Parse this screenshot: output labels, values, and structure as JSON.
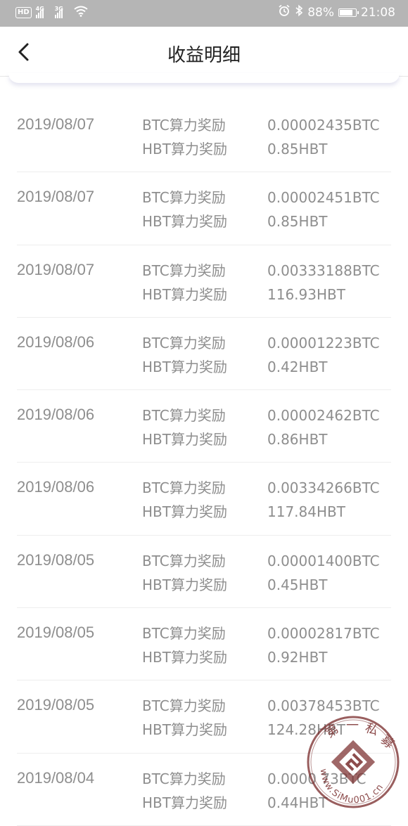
{
  "status_bar": {
    "left_badge": "HD",
    "net1": "4G",
    "net2": "3G",
    "battery_text": "88%",
    "battery_level": 0.88,
    "time": "21:08"
  },
  "header": {
    "title": "收益明细"
  },
  "records": [
    {
      "date": "2019/08/07",
      "btc_label": "BTC算力奖励",
      "hbt_label": "HBT算力奖励",
      "btc_value": "0.00002435BTC",
      "hbt_value": "0.85HBT"
    },
    {
      "date": "2019/08/07",
      "btc_label": "BTC算力奖励",
      "hbt_label": "HBT算力奖励",
      "btc_value": "0.00002451BTC",
      "hbt_value": "0.85HBT"
    },
    {
      "date": "2019/08/07",
      "btc_label": "BTC算力奖励",
      "hbt_label": "HBT算力奖励",
      "btc_value": "0.00333188BTC",
      "hbt_value": "116.93HBT"
    },
    {
      "date": "2019/08/06",
      "btc_label": "BTC算力奖励",
      "hbt_label": "HBT算力奖励",
      "btc_value": "0.00001223BTC",
      "hbt_value": "0.42HBT"
    },
    {
      "date": "2019/08/06",
      "btc_label": "BTC算力奖励",
      "hbt_label": "HBT算力奖励",
      "btc_value": "0.00002462BTC",
      "hbt_value": "0.86HBT"
    },
    {
      "date": "2019/08/06",
      "btc_label": "BTC算力奖励",
      "hbt_label": "HBT算力奖励",
      "btc_value": "0.00334266BTC",
      "hbt_value": "117.84HBT"
    },
    {
      "date": "2019/08/05",
      "btc_label": "BTC算力奖励",
      "hbt_label": "HBT算力奖励",
      "btc_value": "0.00001400BTC",
      "hbt_value": "0.45HBT"
    },
    {
      "date": "2019/08/05",
      "btc_label": "BTC算力奖励",
      "hbt_label": "HBT算力奖励",
      "btc_value": "0.00002817BTC",
      "hbt_value": "0.92HBT"
    },
    {
      "date": "2019/08/05",
      "btc_label": "BTC算力奖励",
      "hbt_label": "HBT算力奖励",
      "btc_value": "0.00378453BTC",
      "hbt_value": "124.28HBT"
    },
    {
      "date": "2019/08/04",
      "btc_label": "BTC算力奖励",
      "hbt_label": "HBT算力奖励",
      "btc_value": "0.0000 73BTC",
      "hbt_value": "0.44HBT"
    }
  ],
  "watermark": {
    "chars": [
      "第",
      "一",
      "私",
      "募"
    ],
    "url": "www.SiMu001.cn"
  },
  "colors": {
    "status_bar_bg": "#b5b5b5",
    "text_gray": "#8e8e8e",
    "title": "#222222",
    "divider": "#eeeeee",
    "watermark": "#7a2e2e"
  }
}
